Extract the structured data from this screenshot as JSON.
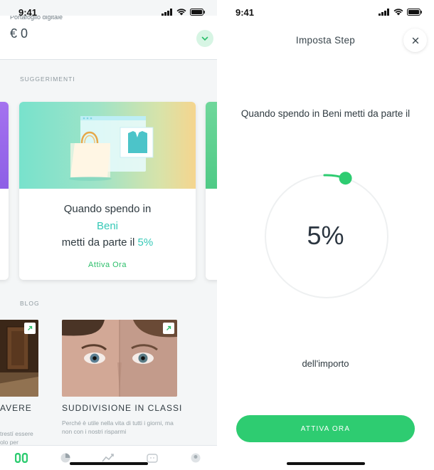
{
  "status_bar": {
    "time": "9:41"
  },
  "left": {
    "header": {
      "cut_label": "Portafoglio digitale",
      "amount": "€ 0"
    },
    "suggestions": {
      "label": "SUGGERIMENTI",
      "card": {
        "line1": "Quando spendo in",
        "category": "Beni",
        "line3_prefix": "metti da parte il ",
        "percent": "5%",
        "cta": "Attiva Ora"
      }
    },
    "blog": {
      "label": "BLOG",
      "posts": [
        {
          "title": "AVERE",
          "desc": "trestí essere olo per"
        },
        {
          "title": "SUDDIVISIONE IN CLASSI",
          "desc": "Perché è utile nella vita di tutti i giorni, ma non con i nostri risparmi"
        }
      ]
    },
    "tabs": [
      "home-tab",
      "wallet-tab",
      "stats-tab",
      "goals-tab",
      "profile-tab"
    ]
  },
  "right": {
    "title": "Imposta Step",
    "sentence": "Quando spendo in Beni metti da parte il",
    "dial_value": "5%",
    "dial_fraction": 0.05,
    "suffix": "dell'importo",
    "button": "ATTIVA ORA"
  },
  "colors": {
    "accent_green": "#2ecc71",
    "teal_text": "#36c9b7"
  }
}
